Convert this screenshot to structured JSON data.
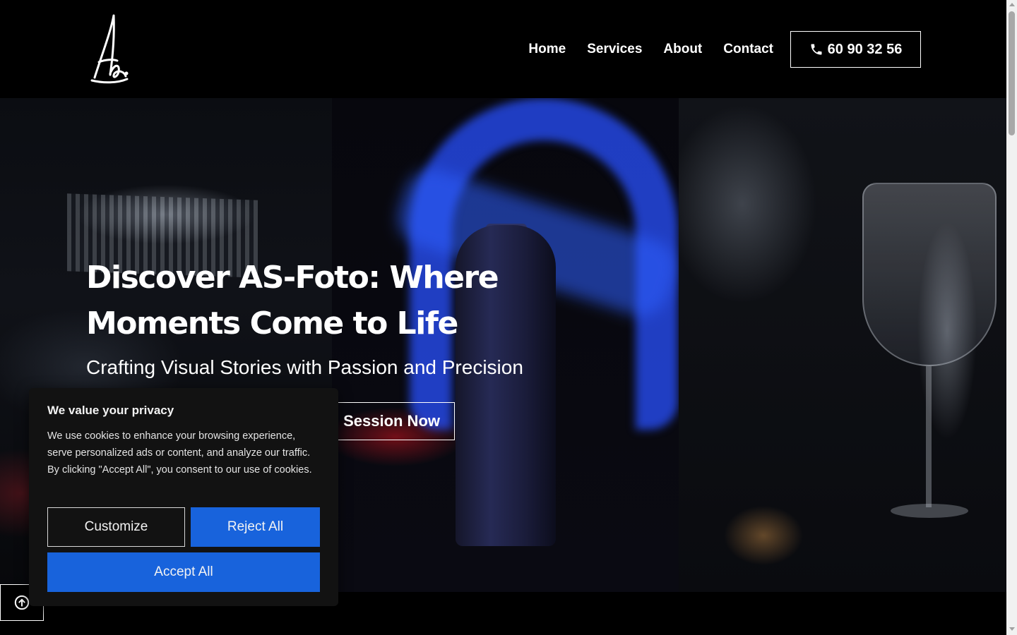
{
  "header": {
    "logo_icon": "signature-logo",
    "nav": [
      {
        "label": "Home"
      },
      {
        "label": "Services"
      },
      {
        "label": "About"
      },
      {
        "label": "Contact"
      }
    ],
    "phone": {
      "icon": "phone-icon",
      "label": "60 90 32 56"
    }
  },
  "hero": {
    "title": "Discover AS-Foto: Where Moments Come to Life",
    "subtitle": "Crafting Visual Stories with Passion and Precision",
    "cta_label": "Session Now"
  },
  "cookie": {
    "title": "We value your privacy",
    "text": "We use cookies to enhance your browsing experience, serve personalized ads or content, and analyze our traffic. By clicking \"Accept All\", you consent to our use of cookies.",
    "customize_label": "Customize",
    "reject_label": "Reject All",
    "accept_label": "Accept All",
    "accent_color": "#1863dc"
  },
  "back_to_top": {
    "icon": "arrow-up-circle-icon"
  }
}
